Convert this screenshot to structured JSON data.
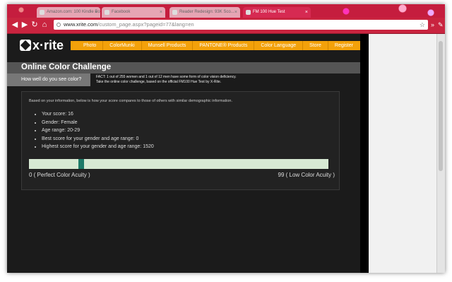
{
  "browser": {
    "tabs": [
      {
        "label": "Amazon.com: 100 Kindle Bo"
      },
      {
        "label": "Facebook"
      },
      {
        "label": "Reader Redesign: 93K Sco..."
      },
      {
        "label": "FM 100 Hue Test"
      }
    ],
    "url_prefix": "www.xrite.com",
    "url_suffix": "/custom_page.aspx?pageid=77&lang=en",
    "accent": "#c9243f"
  },
  "site": {
    "logo_text": "x·rite",
    "nav": [
      "Photo",
      "ColorMunki",
      "Munsell Products",
      "PANTONE® Products",
      "Color Language",
      "Store",
      "Register"
    ],
    "nav_color": "#f3a10a",
    "banner_title": "Online Color Challenge",
    "question": "How well do you see color?",
    "fact_line1": "FACT: 1 out of 255 women and 1 out of 12 men have some form of color vision deficiency.",
    "fact_line2": "Take the online color challenge, based on the official FM100 Hue Test by X-Rite."
  },
  "results": {
    "intro": "Based on your information, below is how your score compares to those of others with similar demographic information.",
    "items": [
      "Your score: 16",
      "Gender: Female",
      "Age range: 20-29",
      "Best score for your gender and age range: 0",
      "Highest score for your gender and age range: 1520"
    ],
    "scale": {
      "min_label": "0 ( Perfect Color Acuity )",
      "max_label": "99 ( Low Color Acuity )",
      "score": 16,
      "max": 99,
      "bar_color": "#d7e9d3",
      "marker_color": "#1d7a68"
    }
  }
}
